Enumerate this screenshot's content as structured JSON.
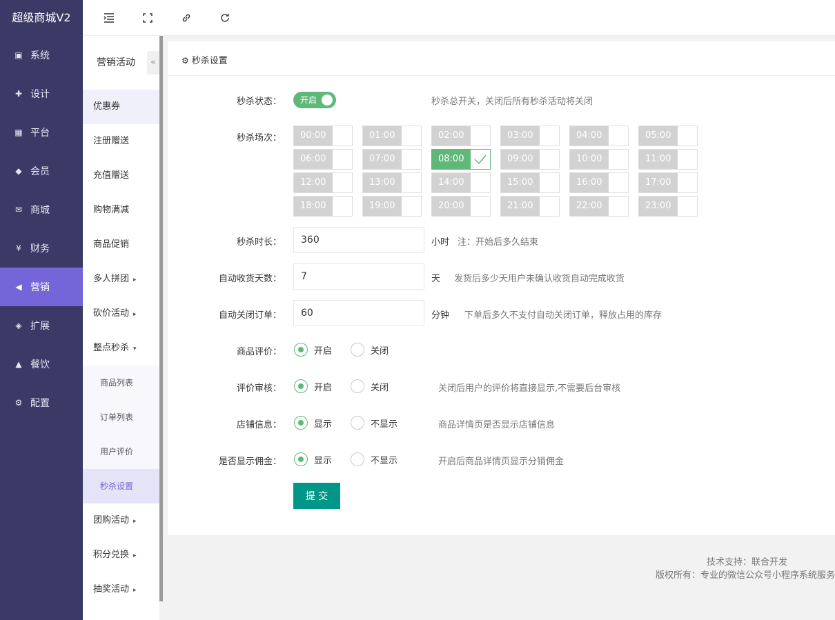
{
  "brand": "超级商城V2",
  "nav": [
    {
      "label": "系统",
      "icon": "monitor-icon",
      "active": false
    },
    {
      "label": "设计",
      "icon": "puzzle-icon",
      "active": false
    },
    {
      "label": "平台",
      "icon": "grid-icon",
      "active": false
    },
    {
      "label": "会员",
      "icon": "diamond-icon",
      "active": false
    },
    {
      "label": "商城",
      "icon": "envelope-icon",
      "active": false
    },
    {
      "label": "财务",
      "icon": "yen-icon",
      "active": false
    },
    {
      "label": "营销",
      "icon": "megaphone-icon",
      "active": true
    },
    {
      "label": "扩展",
      "icon": "cube-icon",
      "active": false
    },
    {
      "label": "餐饮",
      "icon": "dish-icon",
      "active": false
    },
    {
      "label": "配置",
      "icon": "gear-icon",
      "active": false
    }
  ],
  "submenu": {
    "title": "营销活动",
    "collapse": "«",
    "items": [
      {
        "label": "优惠券"
      },
      {
        "label": "注册赠送"
      },
      {
        "label": "充值赠送"
      },
      {
        "label": "购物满减"
      },
      {
        "label": "商品促销"
      },
      {
        "label": "多人拼团",
        "caret": "▸"
      },
      {
        "label": "砍价活动",
        "caret": "▸"
      },
      {
        "label": "整点秒杀",
        "caret": "▾"
      },
      {
        "label": "商品列表",
        "child": true
      },
      {
        "label": "订单列表",
        "child": true
      },
      {
        "label": "用户评价",
        "child": true
      },
      {
        "label": "秒杀设置",
        "child": true,
        "active": true
      },
      {
        "label": "团购活动",
        "caret": "▸"
      },
      {
        "label": "积分兑换",
        "caret": "▸"
      },
      {
        "label": "抽奖活动",
        "caret": "▸"
      }
    ]
  },
  "panel": {
    "title": "秒杀设置"
  },
  "form": {
    "status_label": "秒杀状态：",
    "status_toggle": "开启",
    "status_hint": "秒杀总开关，关闭后所有秒杀活动将关闭",
    "slots_label": "秒杀场次：",
    "slots": [
      "00:00",
      "01:00",
      "02:00",
      "03:00",
      "04:00",
      "05:00",
      "06:00",
      "07:00",
      "08:00",
      "09:00",
      "10:00",
      "11:00",
      "12:00",
      "13:00",
      "14:00",
      "15:00",
      "16:00",
      "17:00",
      "18:00",
      "19:00",
      "20:00",
      "21:00",
      "22:00",
      "23:00"
    ],
    "selected_slot": "08:00",
    "duration_label": "秒杀时长：",
    "duration_value": "360",
    "duration_unit": "小时",
    "duration_hint": "注：开始后多久结束",
    "autoreceive_label": "自动收货天数：",
    "autoreceive_value": "7",
    "autoreceive_unit": "天",
    "autoreceive_hint": "发货后多少天用户未确认收货自动完成收货",
    "autoclose_label": "自动关闭订单：",
    "autoclose_value": "60",
    "autoclose_unit": "分钟",
    "autoclose_hint": "下单后多久不支付自动关闭订单，释放占用的库存",
    "review_label": "商品评价：",
    "review_on": "开启",
    "review_off": "关闭",
    "audit_label": "评价审核：",
    "audit_on": "开启",
    "audit_off": "关闭",
    "audit_hint": "关闭后用户的评价将直接显示,不需要后台审核",
    "shop_label": "店铺信息：",
    "shop_on": "显示",
    "shop_off": "不显示",
    "shop_hint": "商品详情页是否显示店铺信息",
    "commission_label": "是否显示佣金：",
    "commission_on": "显示",
    "commission_off": "不显示",
    "commission_hint": "开启后商品详情页显示分销佣金",
    "submit": "提 交"
  },
  "footer": {
    "support": "技术支持：联合开发",
    "copyright": "版权所有：专业的微信公众号小程序系统服务"
  },
  "colors": {
    "sidebar": "#3b3a66",
    "active_nav": "#7466d8",
    "green": "#5fb878",
    "submit": "#009688"
  }
}
